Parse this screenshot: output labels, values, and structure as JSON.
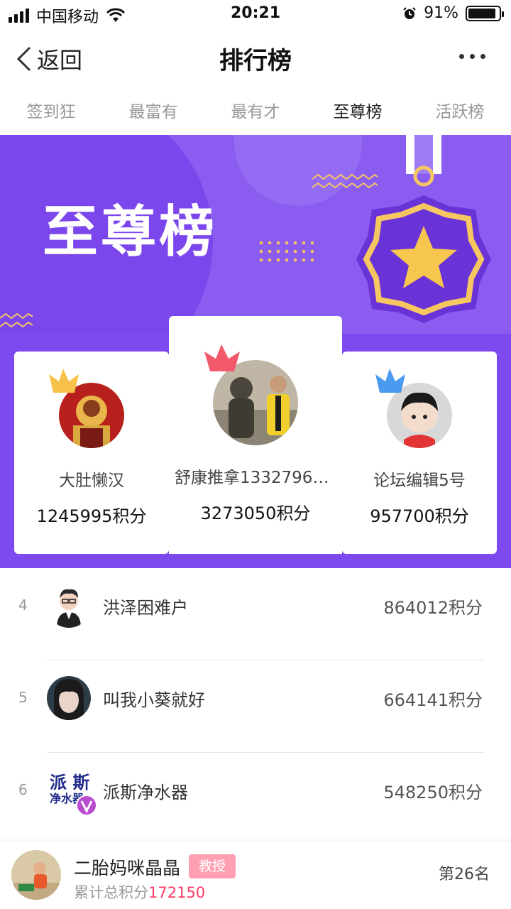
{
  "status_bar": {
    "carrier": "中国移动",
    "time": "20:21",
    "battery": "91%",
    "battery_level": 0.91
  },
  "nav": {
    "back_label": "返回",
    "title": "排行榜"
  },
  "tabs": [
    {
      "label": "签到狂",
      "active": false
    },
    {
      "label": "最富有",
      "active": false
    },
    {
      "label": "最有才",
      "active": false
    },
    {
      "label": "至尊榜",
      "active": true
    },
    {
      "label": "活跃榜",
      "active": false
    }
  ],
  "banner": {
    "title": "至尊榜"
  },
  "podium": [
    {
      "rank": 1,
      "name": "舒康推拿13327961…",
      "score": "3273050积分",
      "crown_color": "#f25a6c"
    },
    {
      "rank": 2,
      "name": "大肚懒汉",
      "score": "1245995积分",
      "crown_color": "#f8c24a"
    },
    {
      "rank": 3,
      "name": "论坛编辑5号",
      "score": "957700积分",
      "crown_color": "#4a9af0"
    }
  ],
  "list": [
    {
      "rank": "4",
      "name": "洪泽困难户",
      "score": "864012积分"
    },
    {
      "rank": "5",
      "name": "叫我小葵就好",
      "score": "664141积分"
    },
    {
      "rank": "6",
      "name": "派斯净水器",
      "score": "548250积分",
      "avatar_text": "派 斯 净水器"
    }
  ],
  "me": {
    "name": "二胎妈咪晶晶",
    "badge": "教授",
    "score_label": "累计总积分",
    "score": "172150",
    "rank": "第26名"
  }
}
